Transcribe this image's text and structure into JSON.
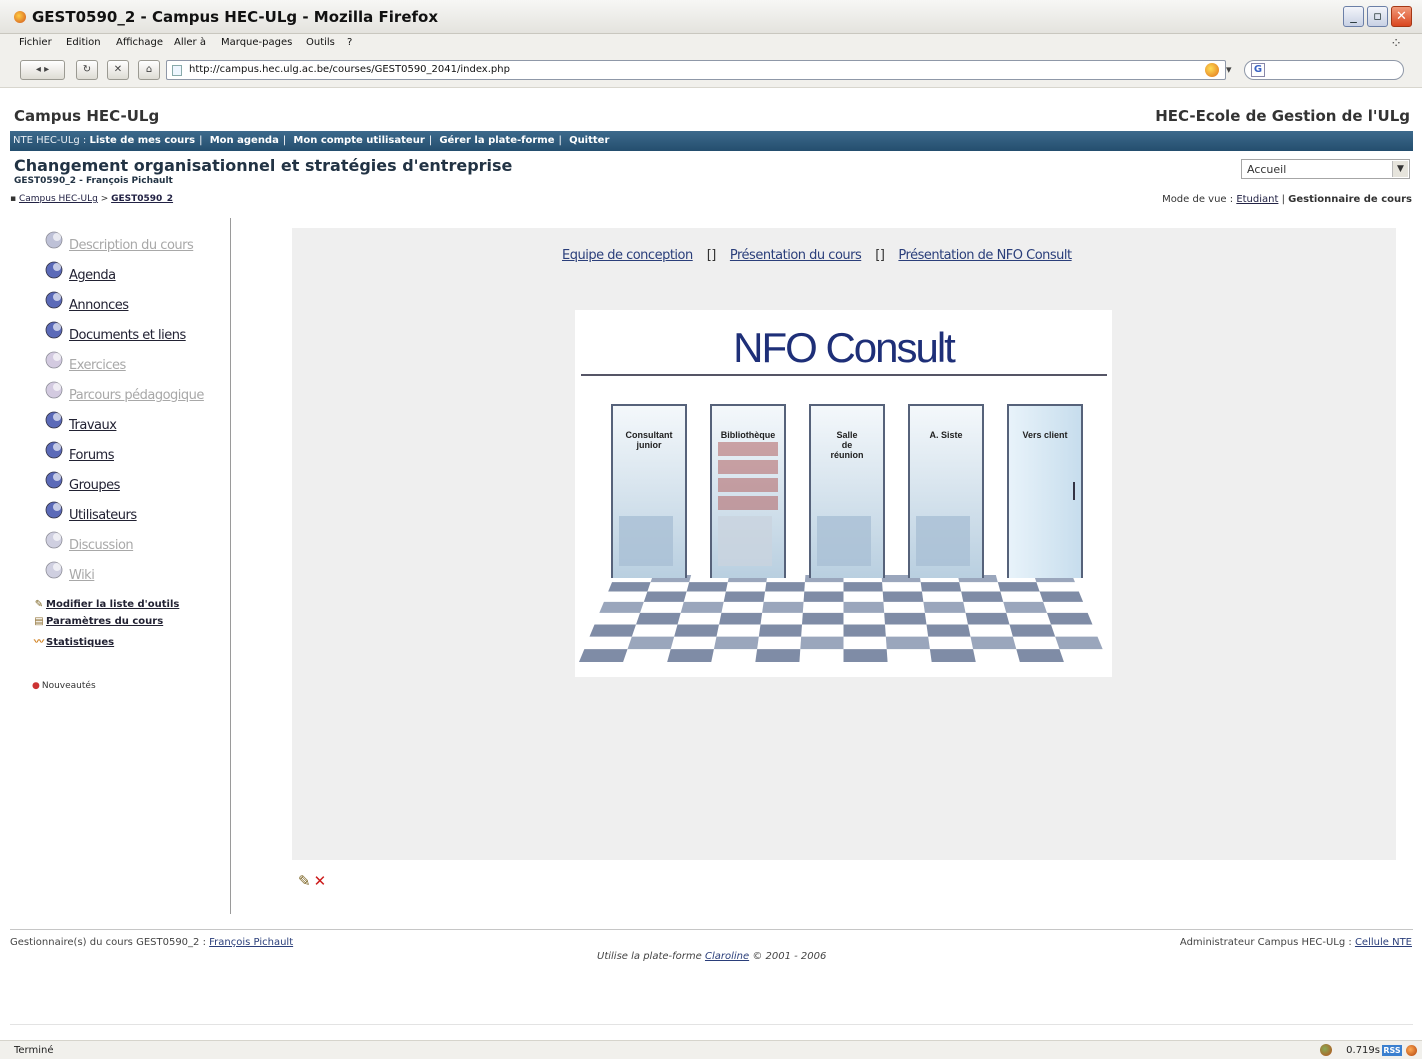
{
  "window": {
    "title": "GEST0590_2 - Campus HEC-ULg - Mozilla Firefox"
  },
  "menubar": {
    "items": [
      "Fichier",
      "Edition",
      "Affichage",
      "Aller à",
      "Marque-pages",
      "Outils",
      "?"
    ]
  },
  "navbar": {
    "url": "http://campus.hec.ulg.ac.be/courses/GEST0590_2041/index.php",
    "search_value": ""
  },
  "header": {
    "site_title": "Campus HEC-ULg",
    "institution": "HEC-Ecole de Gestion de l'ULg"
  },
  "bluebar": {
    "prefix": "NTE HEC-ULg : ",
    "links": [
      "Liste de mes cours",
      "Mon agenda",
      "Mon compte utilisateur",
      "Gérer la plate-forme",
      "Quitter"
    ]
  },
  "course": {
    "title": "Changement organisationnel et stratégies d'entreprise",
    "subtitle": "GEST0590_2 - François Pichault",
    "breadcrumb_root": "Campus HEC-ULg",
    "breadcrumb_separator": " > ",
    "breadcrumb_current": "GEST0590_2"
  },
  "select": {
    "value": "Accueil"
  },
  "viewmode": {
    "label": "Mode de vue : ",
    "student": "Etudiant",
    "separator": " | ",
    "manager": "Gestionnaire de cours"
  },
  "sidebar": {
    "tools": [
      {
        "label": "Description du cours",
        "state": "inactive",
        "icon": "description-icon"
      },
      {
        "label": "Agenda",
        "state": "active",
        "icon": "agenda-icon"
      },
      {
        "label": "Annonces",
        "state": "active",
        "icon": "announcements-icon"
      },
      {
        "label": "Documents et liens",
        "state": "active",
        "icon": "documents-icon"
      },
      {
        "label": "Exercices",
        "state": "inactive",
        "icon": "exercises-icon"
      },
      {
        "label": "Parcours pédagogique",
        "state": "inactive",
        "icon": "learning-path-icon"
      },
      {
        "label": "Travaux",
        "state": "active",
        "icon": "assignments-icon"
      },
      {
        "label": "Forums",
        "state": "active",
        "icon": "forums-icon"
      },
      {
        "label": "Groupes",
        "state": "active",
        "icon": "groups-icon"
      },
      {
        "label": "Utilisateurs",
        "state": "active",
        "icon": "users-icon"
      },
      {
        "label": "Discussion",
        "state": "inactive",
        "icon": "chat-icon"
      },
      {
        "label": "Wiki",
        "state": "inactive",
        "icon": "wiki-icon"
      }
    ],
    "admin_links": [
      {
        "label": "Modifier la liste d'outils",
        "icon": "pencil-icon"
      },
      {
        "label": "Paramètres du cours",
        "icon": "settings-icon"
      },
      {
        "label": "Statistiques",
        "icon": "statistics-icon"
      }
    ],
    "news": "Nouveautés"
  },
  "main": {
    "links": [
      "Equipe de conception",
      "Présentation du cours",
      "Présentation de NFO Consult"
    ],
    "link_separator": "[]",
    "image": {
      "title": "NFO Consult",
      "doors": [
        [
          "Consultant",
          "junior"
        ],
        [
          "Bibliothèque"
        ],
        [
          "Salle",
          "de",
          "réunion"
        ],
        [
          "A. Siste"
        ],
        [
          "Vers client"
        ]
      ]
    }
  },
  "footer": {
    "left_label": "Gestionnaire(s) du cours GEST0590_2 : ",
    "left_link": "François Pichault",
    "center_prefix": "Utilise la plate-forme ",
    "center_link": "Claroline",
    "center_suffix": " © 2001 - 2006",
    "right_label": "Administrateur Campus HEC-ULg : ",
    "right_link": "Cellule NTE"
  },
  "statusbar": {
    "status": "Terminé",
    "timing": "0.719s",
    "rss": "RSS"
  },
  "colors": {
    "bluebar": "#2f5a7c",
    "panel_bg": "#efefef",
    "nfo_title": "#1e2f78",
    "link": "#2a3e7a",
    "inactive_tool": "#a8a8a8"
  }
}
